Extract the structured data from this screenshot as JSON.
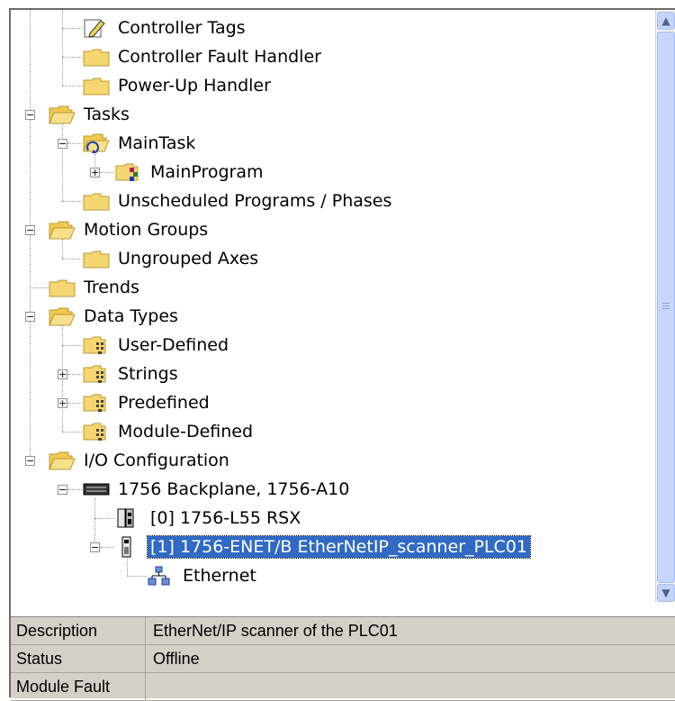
{
  "tree": {
    "items": [
      {
        "label": "Controller Tags",
        "icon": "tag-edit-icon"
      },
      {
        "label": "Controller Fault Handler",
        "icon": "folder-icon"
      },
      {
        "label": "Power-Up Handler",
        "icon": "folder-icon"
      },
      {
        "label": "Tasks",
        "icon": "folder-open-icon"
      },
      {
        "label": "MainTask",
        "icon": "task-folder-icon"
      },
      {
        "label": "MainProgram",
        "icon": "program-folder-icon"
      },
      {
        "label": "Unscheduled Programs / Phases",
        "icon": "folder-icon"
      },
      {
        "label": "Motion Groups",
        "icon": "folder-open-icon"
      },
      {
        "label": "Ungrouped Axes",
        "icon": "folder-icon"
      },
      {
        "label": "Trends",
        "icon": "folder-icon"
      },
      {
        "label": "Data Types",
        "icon": "folder-open-icon"
      },
      {
        "label": "User-Defined",
        "icon": "datatype-folder-icon"
      },
      {
        "label": "Strings",
        "icon": "datatype-folder-icon"
      },
      {
        "label": "Predefined",
        "icon": "datatype-folder-icon"
      },
      {
        "label": "Module-Defined",
        "icon": "datatype-folder-icon"
      },
      {
        "label": "I/O Configuration",
        "icon": "folder-open-icon"
      },
      {
        "label": "1756 Backplane, 1756-A10",
        "icon": "backplane-icon"
      },
      {
        "label": "[0] 1756-L55 RSX",
        "icon": "controller-module-icon"
      },
      {
        "label": "[1] 1756-ENET/B EtherNetIP_scanner_PLC01",
        "icon": "ethernet-module-icon",
        "selected": true
      },
      {
        "label": "Ethernet",
        "icon": "network-icon"
      }
    ]
  },
  "properties": {
    "rows": [
      {
        "name": "Description",
        "value": "EtherNet/IP scanner of the PLC01"
      },
      {
        "name": "Status",
        "value": "Offline"
      },
      {
        "name": "Module Fault",
        "value": ""
      }
    ]
  },
  "colors": {
    "selection": "#316ac5",
    "folder": "#f5d670",
    "scrollbar": "#c4d3fb",
    "panel": "#d4d0c8"
  }
}
